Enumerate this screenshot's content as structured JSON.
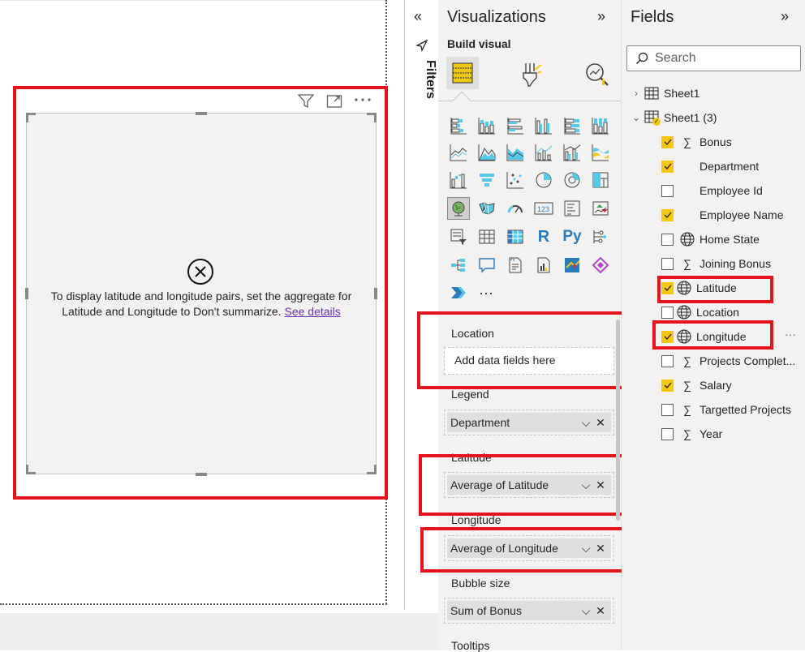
{
  "visual": {
    "error_message": "To display latitude and longitude pairs, set the aggregate for Latitude and Longitude to Don't summarize.",
    "see_details_link": "See details"
  },
  "filters": {
    "label": "Filters"
  },
  "visualizations": {
    "title": "Visualizations",
    "build_visual_label": "Build visual",
    "more_visuals": "···",
    "wells": {
      "location": {
        "label": "Location",
        "placeholder": "Add data fields here"
      },
      "legend": {
        "label": "Legend",
        "value": "Department"
      },
      "latitude": {
        "label": "Latitude",
        "value": "Average of Latitude"
      },
      "longitude": {
        "label": "Longitude",
        "value": "Average of Longitude"
      },
      "bubble_size": {
        "label": "Bubble size",
        "value": "Sum of Bonus"
      },
      "tooltips": {
        "label": "Tooltips"
      }
    }
  },
  "fields": {
    "title": "Fields",
    "search_placeholder": "Search",
    "tables": [
      {
        "name": "Sheet1",
        "expanded": false
      },
      {
        "name": "Sheet1 (3)",
        "expanded": true
      }
    ],
    "items": [
      {
        "name": "Bonus",
        "checked": true,
        "icon": "sigma-icon"
      },
      {
        "name": "Department",
        "checked": true,
        "icon": "none"
      },
      {
        "name": "Employee Id",
        "checked": false,
        "icon": "none"
      },
      {
        "name": "Employee Name",
        "checked": true,
        "icon": "none"
      },
      {
        "name": "Home State",
        "checked": false,
        "icon": "globe-icon"
      },
      {
        "name": "Joining Bonus",
        "checked": false,
        "icon": "sigma-icon"
      },
      {
        "name": "Latitude",
        "checked": true,
        "icon": "globe-icon"
      },
      {
        "name": "Location",
        "checked": false,
        "icon": "globe-icon"
      },
      {
        "name": "Longitude",
        "checked": true,
        "icon": "globe-icon"
      },
      {
        "name": "Projects Complet...",
        "checked": false,
        "icon": "sigma-icon"
      },
      {
        "name": "Salary",
        "checked": true,
        "icon": "sigma-icon"
      },
      {
        "name": "Targetted Projects",
        "checked": false,
        "icon": "sigma-icon"
      },
      {
        "name": "Year",
        "checked": false,
        "icon": "sigma-icon"
      }
    ],
    "more_options": "···"
  },
  "colors": {
    "highlight_red": "#e3141b",
    "checkbox_yellow": "#f2c811",
    "pane_bg": "#f3f2f1",
    "link_purple": "#6b2fb3"
  }
}
